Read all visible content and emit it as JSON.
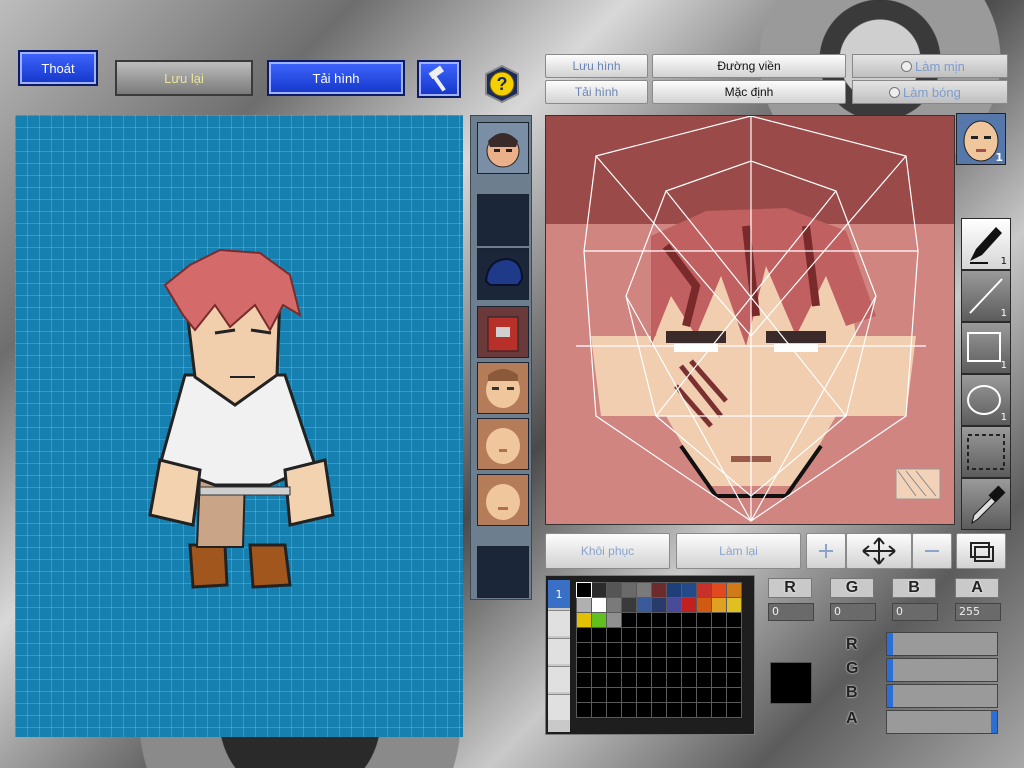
{
  "toolbar": {
    "exit_label": "Thoát",
    "save_label": "Lưu lại",
    "upload_label": "Tải hình",
    "hammer_icon": "hammer-icon",
    "help_icon": "question-icon"
  },
  "editor_top": {
    "save_label": "Lưu hình",
    "upload_label": "Tải hình",
    "outline_label": "Đường viền",
    "default_label": "Mặc định",
    "smooth_label": "Làm mịn",
    "shade_label": "Làm bóng"
  },
  "part_slots": [
    {
      "name": "character-face-slot",
      "icon": "character-face"
    },
    {
      "name": "empty-slot-1",
      "icon": "empty"
    },
    {
      "name": "helmet-slot",
      "icon": "helmet"
    },
    {
      "name": "armor-slot",
      "icon": "armor"
    },
    {
      "name": "face-slot-1",
      "icon": "face"
    },
    {
      "name": "face-slot-2",
      "icon": "face"
    },
    {
      "name": "face-slot-3",
      "icon": "face"
    },
    {
      "name": "empty-slot-2",
      "icon": "empty"
    }
  ],
  "tools": [
    {
      "name": "pen-tool",
      "icon": "pen-icon",
      "num": "1"
    },
    {
      "name": "line-tool",
      "icon": "line-icon",
      "num": "1"
    },
    {
      "name": "rect-tool",
      "icon": "rectangle-icon",
      "num": "1"
    },
    {
      "name": "ellipse-tool",
      "icon": "ellipse-icon",
      "num": "1"
    },
    {
      "name": "select-tool",
      "icon": "selection-icon",
      "num": ""
    },
    {
      "name": "eyedropper-tool",
      "icon": "eyedropper-icon",
      "num": ""
    }
  ],
  "avatar_badge_num": "1",
  "bottom_actions": {
    "restore_label": "Khôi phục",
    "redo_label": "Làm lại"
  },
  "color": {
    "r_label": "R",
    "g_label": "G",
    "b_label": "B",
    "a_label": "A",
    "r_value": "0",
    "g_value": "0",
    "b_value": "0",
    "a_value": "255",
    "r": 0,
    "g": 0,
    "b": 0,
    "a": 255,
    "current": "#000000"
  },
  "palette": [
    "#000000",
    "#2b2b2b",
    "#555555",
    "#6a6a6a",
    "#7a7a7a",
    "#6d2b2b",
    "#1f3f7a",
    "#244a8a",
    "#c8302a",
    "#e04a1e",
    "#d07a18",
    "#b0b0b0",
    "#ffffff",
    "#7a7a7a",
    "#3a3a3a",
    "#3a5a9a",
    "#2a3a6a",
    "#4a4a9a",
    "#c02020",
    "#d05a10",
    "#e0a020",
    "#e0c020",
    "#e0c000",
    "#60c020",
    "#909090"
  ],
  "layer_tab_label": "1"
}
